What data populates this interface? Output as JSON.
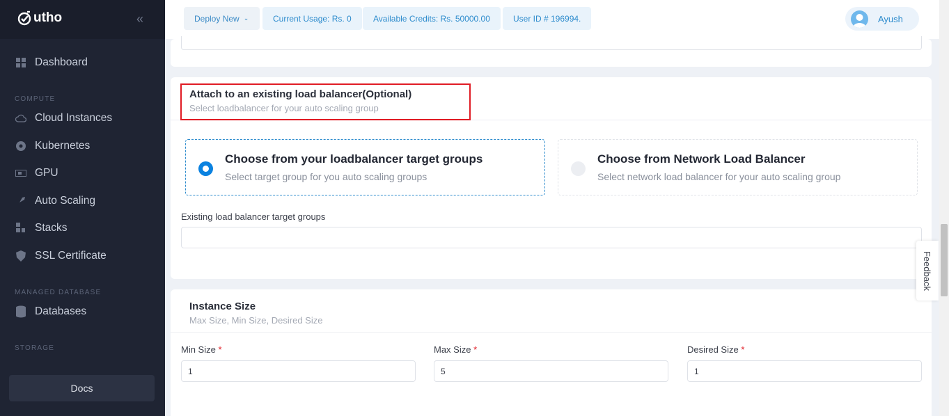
{
  "brand": {
    "name": "utho"
  },
  "sidebar": {
    "collapse_icon": "double-chevron-left-icon",
    "items": [
      {
        "label": "Dashboard",
        "icon": "grid-icon"
      },
      {
        "label": "Cloud Instances",
        "icon": "cloud-icon"
      },
      {
        "label": "Kubernetes",
        "icon": "kubernetes-icon"
      },
      {
        "label": "GPU",
        "icon": "gpu-icon"
      },
      {
        "label": "Auto Scaling",
        "icon": "rocket-icon"
      },
      {
        "label": "Stacks",
        "icon": "stacks-icon"
      },
      {
        "label": "SSL Certificate",
        "icon": "shield-icon"
      },
      {
        "label": "Databases",
        "icon": "database-icon"
      }
    ],
    "sections": {
      "compute": "COMPUTE",
      "managed_database": "MANAGED DATABASE",
      "storage": "STORAGE"
    },
    "docs_label": "Docs"
  },
  "topbar": {
    "deploy_new": "Deploy New",
    "current_usage": "Current Usage: Rs. 0",
    "available_credits": "Available Credits: Rs. 50000.00",
    "user_id": "User ID # 196994.",
    "user_name": "Ayush"
  },
  "load_balancer": {
    "title": "Attach to an existing load balancer(Optional)",
    "subtitle": "Select loadbalancer for your auto scaling group",
    "options": [
      {
        "title": "Choose from your loadbalancer target groups",
        "subtitle": "Select target group for you auto scaling groups",
        "selected": true
      },
      {
        "title": "Choose from Network Load Balancer",
        "subtitle": "Select network load balancer for your auto scaling group",
        "selected": false
      }
    ],
    "target_groups_label": "Existing load balancer target groups",
    "target_groups_value": ""
  },
  "instance_size": {
    "title": "Instance Size",
    "subtitle": "Max Size, Min Size, Desired Size",
    "required_mark": "*",
    "fields": [
      {
        "label": "Min Size",
        "value": "1"
      },
      {
        "label": "Max Size",
        "value": "5"
      },
      {
        "label": "Desired Size",
        "value": "1"
      }
    ]
  },
  "feedback_label": "Feedback",
  "colors": {
    "accent": "#2e8ccd",
    "radio_on": "#0b82e0",
    "highlight": "#e01b24",
    "sidebar_bg": "#1f2433"
  }
}
